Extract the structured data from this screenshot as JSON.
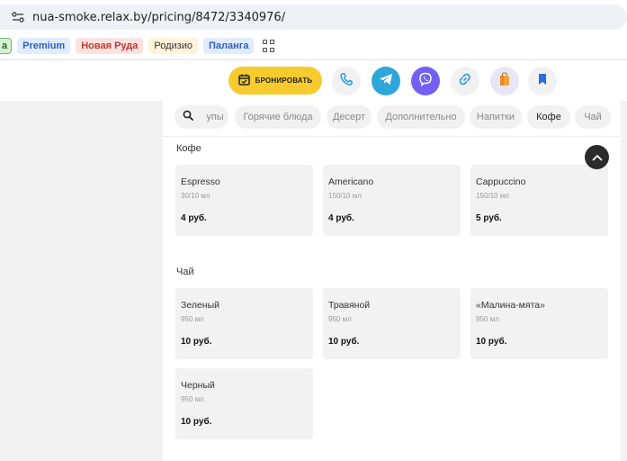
{
  "browser": {
    "url": "nua-smoke.relax.by/pricing/8472/3340976/",
    "bookmarks": [
      {
        "label": "а"
      },
      {
        "label": "Premium"
      },
      {
        "label": "Новая Руда"
      },
      {
        "label": "Родизио"
      },
      {
        "label": "Паланга"
      }
    ]
  },
  "header": {
    "book_label": "БРОНИРОВАТЬ",
    "buttons": [
      {
        "icon": "phone-icon",
        "color": "#2a9ed6"
      },
      {
        "icon": "telegram-icon",
        "color": "#2ea6da"
      },
      {
        "icon": "viber-icon",
        "color": "#7360f2"
      },
      {
        "icon": "link-icon",
        "color": "#2a9ed6"
      },
      {
        "icon": "shopping-bag-icon",
        "color": "#f2a33a"
      },
      {
        "icon": "bookmark-icon",
        "color": "#2a6fdb"
      }
    ]
  },
  "categories": {
    "search_icon": "search-icon",
    "chips": [
      "упы",
      "Горячие блюда",
      "Десерт",
      "Дополнительно",
      "Напитки",
      "Кофе",
      "Чай"
    ],
    "active": "Кофе"
  },
  "sections": [
    {
      "title": "Кофе",
      "items": [
        {
          "name": "Espresso",
          "volume": "30/10 мл",
          "price": "4 руб."
        },
        {
          "name": "Americano",
          "volume": "150/10 мл",
          "price": "4 руб."
        },
        {
          "name": "Cappuccino",
          "volume": "150/10 мл",
          "price": "5 руб."
        }
      ]
    },
    {
      "title": "Чай",
      "items": [
        {
          "name": "Зеленый",
          "volume": "950 мл",
          "price": "10 руб."
        },
        {
          "name": "Травяной",
          "volume": "950 мл",
          "price": "10 руб."
        },
        {
          "name": "«Малина-мята»",
          "volume": "950 мл",
          "price": "10 руб."
        },
        {
          "name": "Черный",
          "volume": "950 мл",
          "price": "10 руб."
        }
      ]
    }
  ]
}
